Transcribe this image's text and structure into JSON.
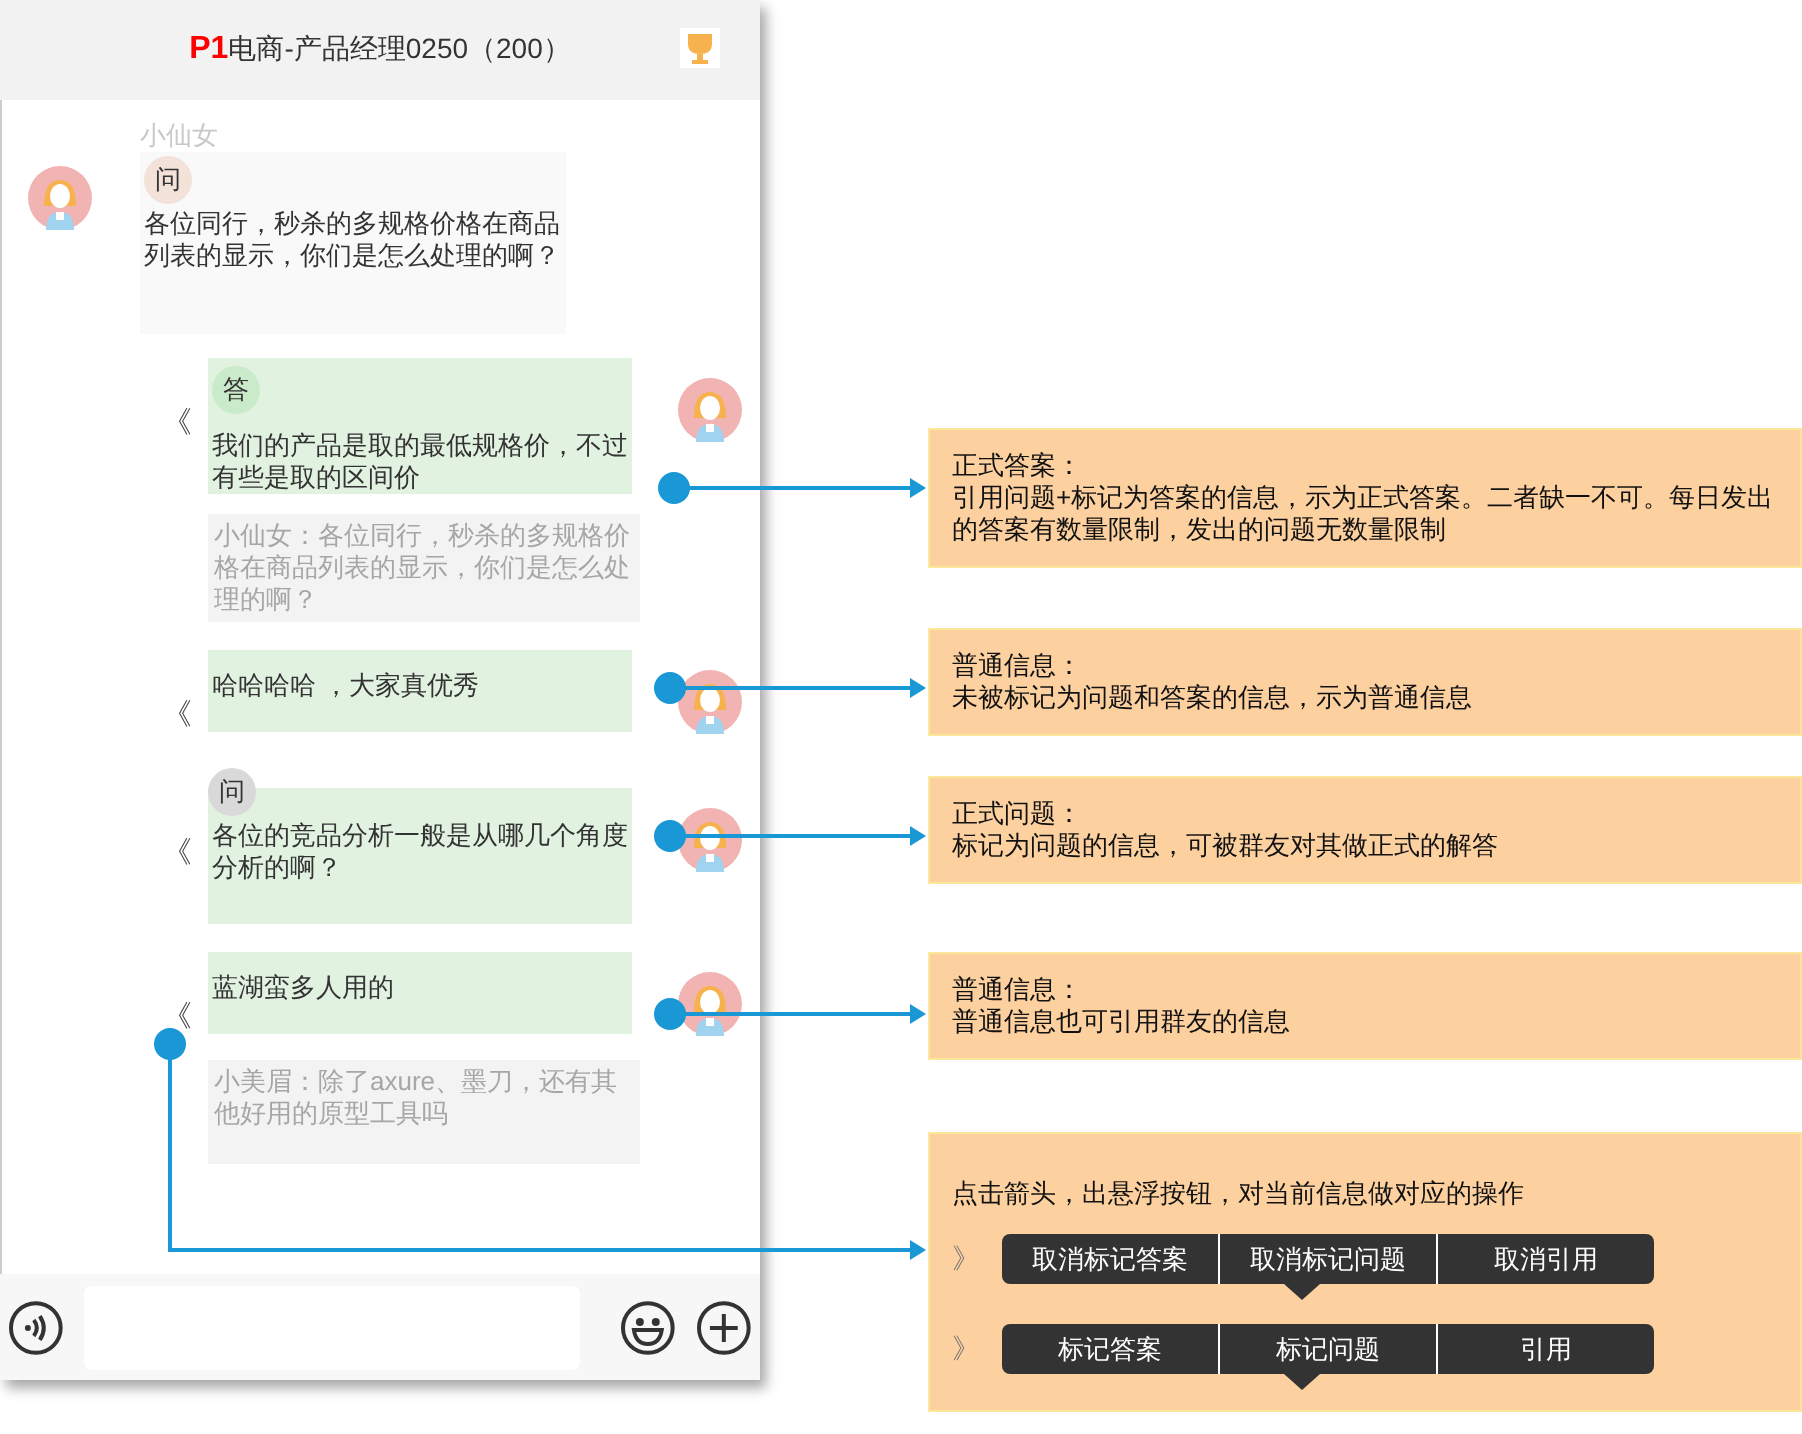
{
  "header": {
    "badge": "P1",
    "title": "电商-产品经理0250（200）"
  },
  "messages": [
    {
      "kind": "incoming",
      "sender": "小仙女",
      "tag": {
        "label": "问",
        "color": "#f3e2d8"
      },
      "text": "各位同行，秒杀的多规格价格在商品列表的显示，你们是怎么处理的啊？"
    },
    {
      "kind": "outgoing",
      "more": "《",
      "tag": {
        "label": "答",
        "color": "#c9ebc9"
      },
      "text": "我们的产品是取的最低规格价，不过有些是取的区间价",
      "quote": "小仙女：各位同行，秒杀的多规格价格在商品列表的显示，你们是怎么处理的啊？"
    },
    {
      "kind": "outgoing",
      "more": "《",
      "text": "哈哈哈哈 ，大家真优秀"
    },
    {
      "kind": "outgoing",
      "more": "《",
      "tag": {
        "label": "问",
        "color": "#d9d9d9"
      },
      "text": "各位的竞品分析一般是从哪几个角度分析的啊？"
    },
    {
      "kind": "outgoing",
      "more": "《",
      "text": "蓝湖蛮多人用的",
      "quote": "小美眉：除了axure、墨刀，还有其他好用的原型工具吗"
    }
  ],
  "notes": [
    {
      "title": "正式答案：",
      "body": "引用问题+标记为答案的信息，示为正式答案。二者缺一不可。每日发出的答案有数量限制，发出的问题无数量限制"
    },
    {
      "title": "普通信息：",
      "body": "未被标记为问题和答案的信息，示为普通信息"
    },
    {
      "title": "正式问题：",
      "body": "标记为问题的信息，可被群友对其做正式的解答"
    },
    {
      "title": "普通信息：",
      "body": "普通信息也可引用群友的信息"
    },
    {
      "body": "点击箭头，出悬浮按钮，对当前信息做对应的操作",
      "action_bars": [
        {
          "arrow": "》",
          "buttons": [
            "取消标记答案",
            "取消标记问题",
            "取消引用"
          ]
        },
        {
          "arrow": "》",
          "buttons": [
            "标记答案",
            "标记问题",
            "引用"
          ]
        }
      ]
    }
  ]
}
